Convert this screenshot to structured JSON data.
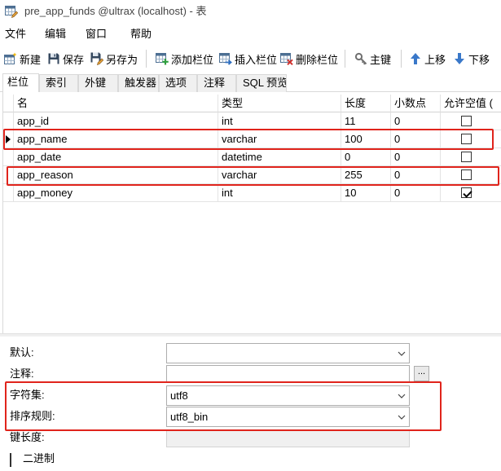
{
  "window": {
    "title": "pre_app_funds @ultrax (localhost) - 表",
    "icon": "table-design-icon"
  },
  "menu": [
    {
      "label": "文件"
    },
    {
      "label": "编辑"
    },
    {
      "label": "窗口"
    },
    {
      "label": "帮助"
    }
  ],
  "toolbar": [
    {
      "label": "新建",
      "icon": "new-table-icon"
    },
    {
      "label": "保存",
      "icon": "save-icon"
    },
    {
      "label": "另存为",
      "icon": "save-as-icon"
    },
    {
      "label": "添加栏位",
      "icon": "add-field-icon"
    },
    {
      "label": "插入栏位",
      "icon": "insert-field-icon"
    },
    {
      "label": "删除栏位",
      "icon": "delete-field-icon"
    },
    {
      "label": "主键",
      "icon": "key-icon"
    },
    {
      "label": "上移",
      "icon": "arrow-up-icon"
    },
    {
      "label": "下移",
      "icon": "arrow-down-icon"
    }
  ],
  "tabs": [
    {
      "label": "栏位",
      "active": true
    },
    {
      "label": "索引",
      "active": false
    },
    {
      "label": "外键",
      "active": false
    },
    {
      "label": "触发器",
      "active": false
    },
    {
      "label": "选项",
      "active": false
    },
    {
      "label": "注释",
      "active": false
    },
    {
      "label": "SQL 预览",
      "active": false
    }
  ],
  "grid": {
    "columns": [
      "名",
      "类型",
      "长度",
      "小数点",
      "允许空值 ("
    ],
    "rows": [
      {
        "name": "app_id",
        "type": "int",
        "length": "11",
        "decimals": "0",
        "nullable": false,
        "current": false
      },
      {
        "name": "app_name",
        "type": "varchar",
        "length": "100",
        "decimals": "0",
        "nullable": false,
        "current": true
      },
      {
        "name": "app_date",
        "type": "datetime",
        "length": "0",
        "decimals": "0",
        "nullable": false,
        "current": false
      },
      {
        "name": "app_reason",
        "type": "varchar",
        "length": "255",
        "decimals": "0",
        "nullable": false,
        "current": false
      },
      {
        "name": "app_money",
        "type": "int",
        "length": "10",
        "decimals": "0",
        "nullable": true,
        "current": false
      }
    ]
  },
  "properties": {
    "default": {
      "label": "默认:",
      "value": ""
    },
    "comment": {
      "label": "注释:",
      "value": "",
      "button": "..."
    },
    "charset": {
      "label": "字符集:",
      "value": "utf8"
    },
    "collation": {
      "label": "排序规则:",
      "value": "utf8_bin"
    },
    "key_length": {
      "label": "键长度:",
      "value": "",
      "disabled": true
    },
    "binary": {
      "label": "二进制",
      "checked": false
    }
  },
  "colors": {
    "annotation": "#e0241c"
  }
}
